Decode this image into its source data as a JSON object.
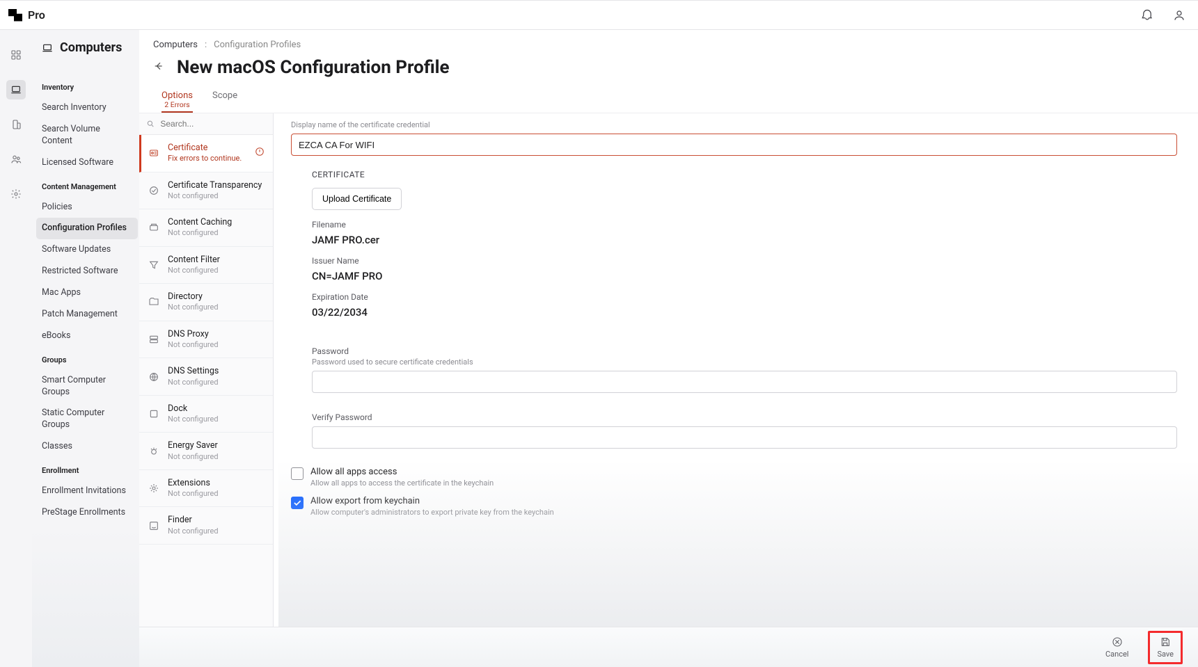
{
  "brand": {
    "name": "Pro"
  },
  "topbar_icons": {
    "bell": "bell-icon",
    "user": "user-icon"
  },
  "rail": [
    {
      "id": "dashboard",
      "icon": "dashboard-icon"
    },
    {
      "id": "computers",
      "icon": "laptop-icon",
      "active": true
    },
    {
      "id": "devices",
      "icon": "devices-icon"
    },
    {
      "id": "users",
      "icon": "users-icon"
    },
    {
      "id": "settings",
      "icon": "gear-icon"
    }
  ],
  "leftnav": {
    "title": "Computers",
    "sections": [
      {
        "label": "Inventory",
        "items": [
          {
            "label": "Search Inventory"
          },
          {
            "label": "Search Volume Content"
          },
          {
            "label": "Licensed Software"
          }
        ]
      },
      {
        "label": "Content Management",
        "items": [
          {
            "label": "Policies"
          },
          {
            "label": "Configuration Profiles",
            "active": true
          },
          {
            "label": "Software Updates"
          },
          {
            "label": "Restricted Software"
          },
          {
            "label": "Mac Apps"
          },
          {
            "label": "Patch Management"
          },
          {
            "label": "eBooks"
          }
        ]
      },
      {
        "label": "Groups",
        "items": [
          {
            "label": "Smart Computer Groups"
          },
          {
            "label": "Static Computer Groups"
          },
          {
            "label": "Classes"
          }
        ]
      },
      {
        "label": "Enrollment",
        "items": [
          {
            "label": "Enrollment Invitations"
          },
          {
            "label": "PreStage Enrollments"
          }
        ]
      }
    ]
  },
  "breadcrumb": {
    "root": "Computers",
    "sep": ":",
    "current": "Configuration Profiles"
  },
  "page_title": "New macOS Configuration Profile",
  "tabs": {
    "options": {
      "label": "Options",
      "errors": "2 Errors"
    },
    "scope": {
      "label": "Scope"
    }
  },
  "search": {
    "placeholder": "Search..."
  },
  "payloads": [
    {
      "title": "Certificate",
      "sub": "Fix errors to continue.",
      "error": true
    },
    {
      "title": "Certificate Transparency",
      "sub": "Not configured"
    },
    {
      "title": "Content Caching",
      "sub": "Not configured"
    },
    {
      "title": "Content Filter",
      "sub": "Not configured"
    },
    {
      "title": "Directory",
      "sub": "Not configured"
    },
    {
      "title": "DNS Proxy",
      "sub": "Not configured"
    },
    {
      "title": "DNS Settings",
      "sub": "Not configured"
    },
    {
      "title": "Dock",
      "sub": "Not configured"
    },
    {
      "title": "Energy Saver",
      "sub": "Not configured"
    },
    {
      "title": "Extensions",
      "sub": "Not configured"
    },
    {
      "title": "Finder",
      "sub": "Not configured"
    }
  ],
  "form": {
    "display_name_help": "Display name of the certificate credential",
    "display_name": "EZCA CA For WIFI",
    "cert_heading": "CERTIFICATE",
    "upload_btn": "Upload Certificate",
    "filename_label": "Filename",
    "filename": "JAMF PRO.cer",
    "issuer_label": "Issuer Name",
    "issuer": "CN=JAMF PRO",
    "exp_label": "Expiration Date",
    "exp": "03/22/2034",
    "password_label": "Password",
    "password_help": "Password used to secure certificate credentials",
    "verify_label": "Verify Password",
    "allow_apps": {
      "title": "Allow all apps access",
      "sub": "Allow all apps to access the certificate in the keychain",
      "checked": false
    },
    "allow_export": {
      "title": "Allow export from keychain",
      "sub": "Allow computer's administrators to export private key from the keychain",
      "checked": true
    }
  },
  "bottombar": {
    "cancel": "Cancel",
    "save": "Save"
  }
}
